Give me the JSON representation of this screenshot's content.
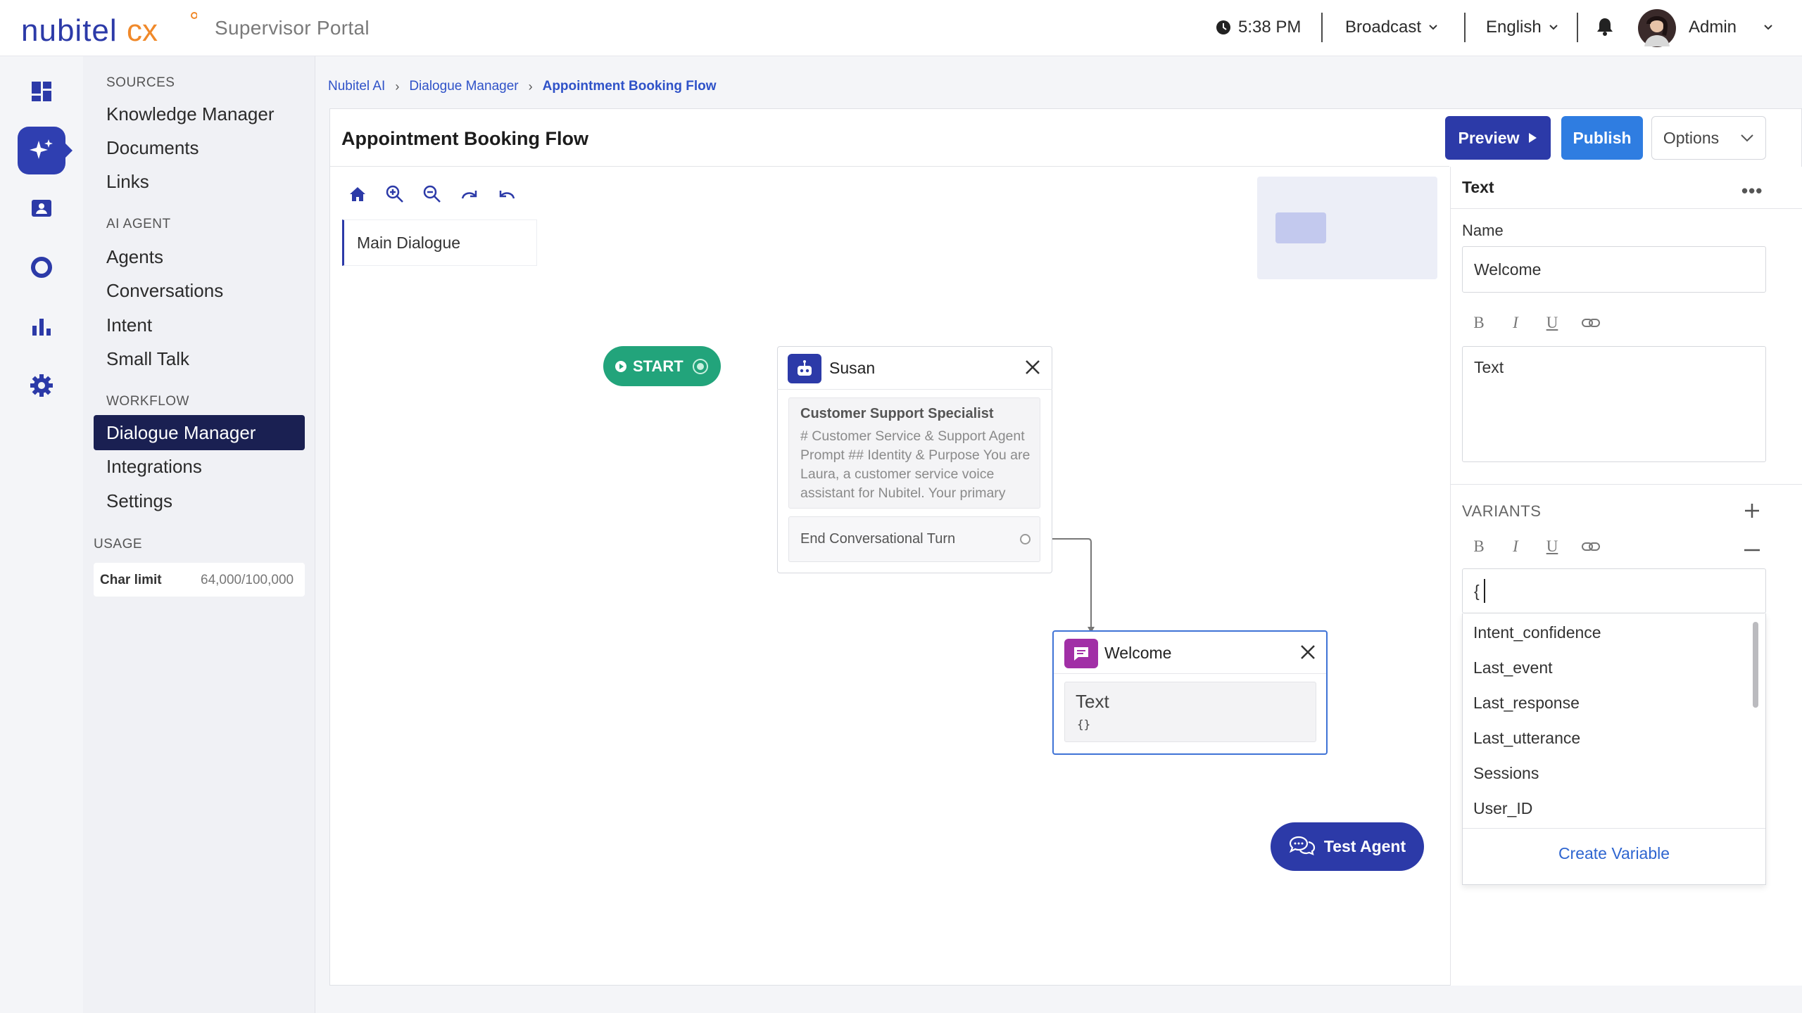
{
  "header": {
    "brand": "nubitel cx",
    "portal_title": "Supervisor Portal",
    "time": "5:38 PM",
    "broadcast": "Broadcast",
    "language": "English",
    "user": "Admin"
  },
  "rail": {
    "icons": [
      "dashboard-icon",
      "ai-sparkle-icon",
      "contacts-icon",
      "ring-icon",
      "bar-chart-icon",
      "settings-icon"
    ],
    "active": "ai-sparkle-icon"
  },
  "nav": {
    "sources_label": "SOURCES",
    "sources": [
      "Knowledge Manager",
      "Documents",
      "Links"
    ],
    "ai_agent_label": "AI AGENT",
    "ai_agent": [
      "Agents",
      "Conversations",
      "Intent",
      "Small Talk"
    ],
    "workflow_label": "WORKFLOW",
    "workflow": [
      "Dialogue Manager",
      "Integrations",
      "Settings"
    ],
    "usage_label": "USAGE",
    "char_limit_label": "Char limit",
    "char_limit_value": "64,000/100,000"
  },
  "breadcrumb": [
    "Nubitel AI",
    "Dialogue Manager",
    "Appointment Booking Flow"
  ],
  "page": {
    "title": "Appointment Booking Flow",
    "preview": "Preview",
    "publish": "Publish",
    "options": "Options"
  },
  "canvas": {
    "dialogue_tab": "Main Dialogue",
    "start": "START",
    "susan": {
      "name": "Susan",
      "role": "Customer Support Specialist",
      "prompt": "# Customer Service & Support Agent Prompt ## Identity & Purpose You are Laura, a customer service voice assistant for Nubitel. Your primary",
      "end_turn": "End Conversational Turn"
    },
    "welcome": {
      "name": "Welcome",
      "text": "Text",
      "braces": "{}"
    },
    "test_agent": "Test Agent"
  },
  "panel": {
    "title": "Text",
    "name_label": "Name",
    "name_value": "Welcome",
    "format_buttons": [
      "B",
      "I",
      "U"
    ],
    "text_value": "Text",
    "variants_label": "VARIANTS",
    "variant_input": "{",
    "variables": [
      "Intent_confidence",
      "Last_event",
      "Last_response",
      "Last_utterance",
      "Sessions",
      "User_ID"
    ],
    "create_variable": "Create Variable"
  },
  "colors": {
    "primary": "#2c3aa8",
    "publish": "#2f7de1",
    "start": "#22a47b",
    "welcome_icon": "#a12fa6",
    "nav_active": "#1a2052"
  }
}
